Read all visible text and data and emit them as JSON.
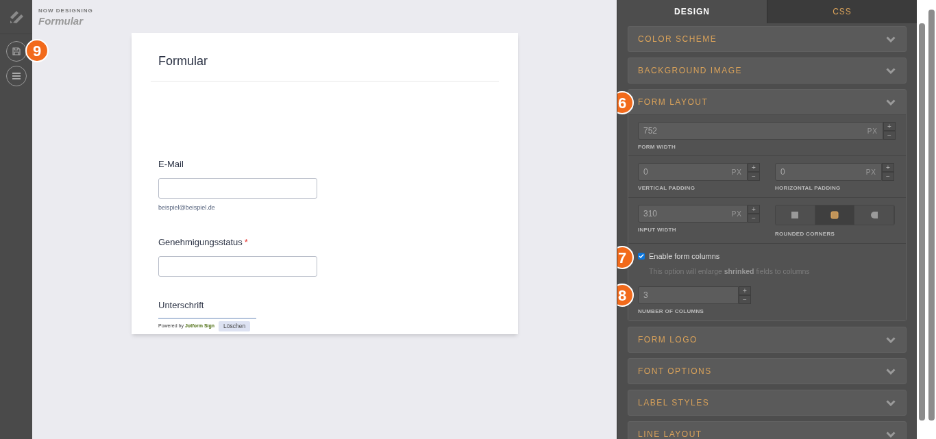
{
  "header": {
    "eyebrow": "NOW DESIGNING",
    "title": "Formular"
  },
  "sidebar_badge": "9",
  "form": {
    "title": "Formular",
    "fields": [
      {
        "kind": "input",
        "label": "E-Mail",
        "sublabel": "beispiel@beispiel.de"
      },
      {
        "kind": "input",
        "label": "Genehmigungsstatus",
        "required_mark": "*"
      },
      {
        "kind": "signature",
        "label": "Unterschrift",
        "powered_prefix": "Powered by",
        "powered_brand": "Jotform Sign",
        "clear_button": "Löschen"
      }
    ]
  },
  "tabs": [
    {
      "label": "DESIGN",
      "selected": true
    },
    {
      "label": "CSS",
      "selected": false
    }
  ],
  "sections": [
    {
      "title": "COLOR SCHEME",
      "expanded": false
    },
    {
      "title": "BACKGROUND IMAGE",
      "expanded": false
    },
    {
      "title": "FORM LAYOUT",
      "expanded": true,
      "badge": "6"
    },
    {
      "title": "FORM LOGO",
      "expanded": false
    },
    {
      "title": "FONT OPTIONS",
      "expanded": false
    },
    {
      "title": "LABEL STYLES",
      "expanded": false
    },
    {
      "title": "LINE LAYOUT",
      "expanded": false
    }
  ],
  "form_layout": {
    "form_width": {
      "value": "752",
      "unit": "PX",
      "label": "FORM WIDTH"
    },
    "vertical_padding": {
      "value": "0",
      "unit": "PX",
      "label": "VERTICAL PADDING"
    },
    "horizontal_padding": {
      "value": "0",
      "unit": "PX",
      "label": "HORIZONTAL PADDING"
    },
    "input_width": {
      "value": "310",
      "unit": "PX",
      "label": "INPUT WIDTH"
    },
    "rounded_corners": {
      "label": "ROUNDED CORNERS",
      "options": [
        {
          "kind": "square",
          "selected": false
        },
        {
          "kind": "rounded",
          "selected": true
        },
        {
          "kind": "round",
          "selected": false
        }
      ]
    },
    "columns_option": {
      "label": "Enable form columns",
      "checked": true,
      "hint": "This option will enlarge **shrinked** fields to columns",
      "badge": "7"
    },
    "number_of_columns": {
      "value": "3",
      "label": "NUMBER OF COLUMNS",
      "badge": "8"
    },
    "stepper": {
      "plus": "+",
      "minus": "−"
    }
  }
}
